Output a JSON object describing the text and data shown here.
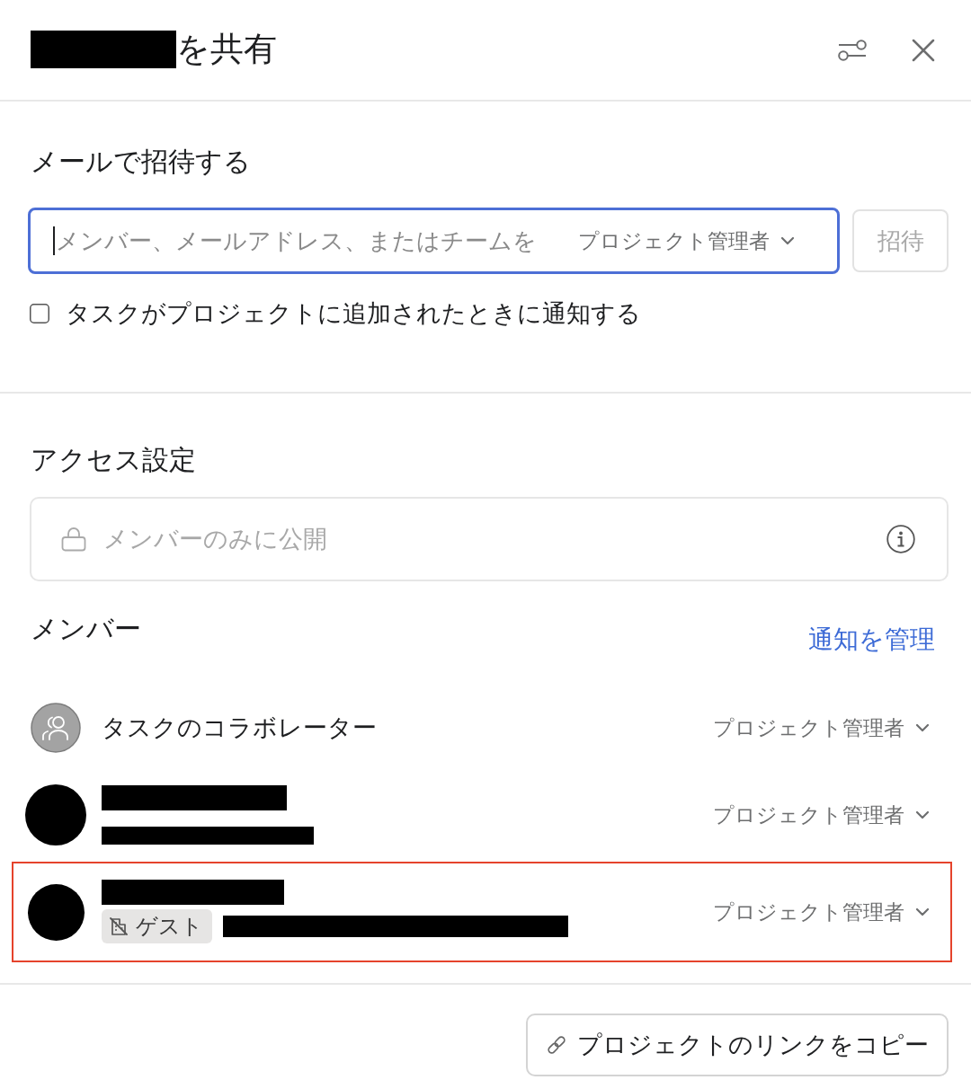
{
  "header": {
    "title": "を共有"
  },
  "invite": {
    "heading": "メールで招待する",
    "field": {
      "placeholder": "メンバー、メールアドレス、またはチームを",
      "focused": true
    },
    "role": "プロジェクト管理者",
    "button": {
      "label": "招待",
      "disabled": true
    },
    "notify": {
      "label": "タスクがプロジェクトに追加されたときに通知する",
      "checked": false
    }
  },
  "access": {
    "heading": "アクセス設定",
    "value": "メンバーのみに公開",
    "disabled": true
  },
  "members": {
    "heading": "メンバー",
    "link": "通知を管理",
    "items": [
      {
        "kind": "group",
        "name": "タスクのコラボレーター",
        "role": "プロジェクト管理者",
        "highlighted": false
      },
      {
        "kind": "person",
        "role": "プロジェクト管理者",
        "highlighted": false
      },
      {
        "kind": "guest",
        "badge": "ゲスト",
        "role": "プロジェクト管理者",
        "highlighted": true
      }
    ]
  },
  "footer": {
    "copy_link": "プロジェクトのリンクをコピー"
  }
}
